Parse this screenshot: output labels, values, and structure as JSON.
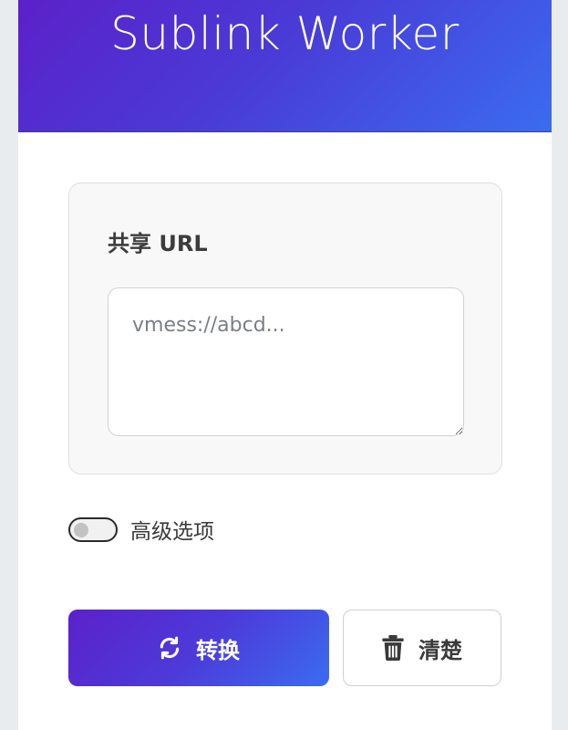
{
  "header": {
    "title": "Sublink Worker"
  },
  "form": {
    "share_url_label": "共享 URL",
    "share_url_placeholder": "vmess://abcd...",
    "share_url_value": ""
  },
  "advanced": {
    "label": "高级选项",
    "enabled": false
  },
  "actions": {
    "convert_label": "转换",
    "clear_label": "清楚"
  },
  "icons": {
    "convert": "sync-icon",
    "clear": "trash-icon"
  },
  "colors": {
    "gradient_start": "#5b21c9",
    "gradient_end": "#3a6cf0"
  }
}
